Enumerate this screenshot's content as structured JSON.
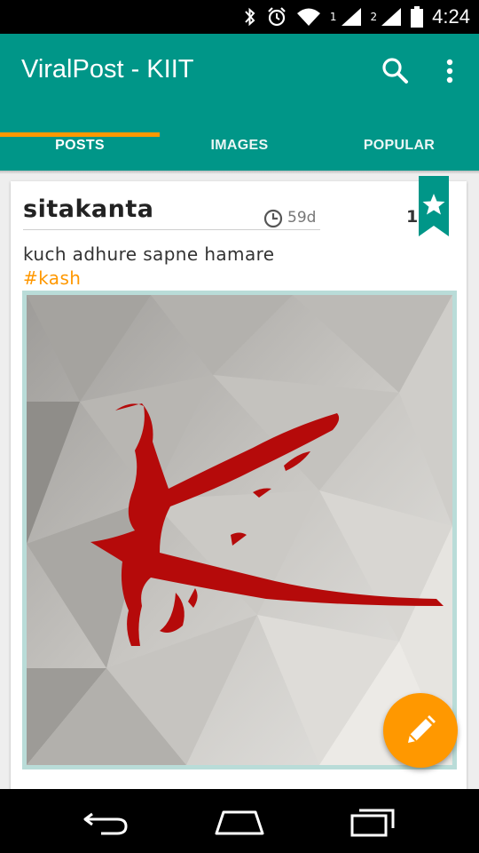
{
  "status_bar": {
    "time": "4:24",
    "sim1_label": "1",
    "sim2_label": "2",
    "icons": [
      "bluetooth-icon",
      "alarm-icon",
      "wifi-icon",
      "signal-icon",
      "signal-icon",
      "battery-icon"
    ]
  },
  "app_bar": {
    "title": "ViralPost - KIIT",
    "actions": [
      "search-icon",
      "more-vert-icon"
    ],
    "color": "#009688"
  },
  "tabs": [
    {
      "label": "POSTS",
      "selected": true
    },
    {
      "label": "IMAGES",
      "selected": false
    },
    {
      "label": "POPULAR",
      "selected": false
    }
  ],
  "tab_indicator_color": "#ff9800",
  "post": {
    "author": "sitakanta",
    "time_ago": "59d",
    "count": "1",
    "text": "kuch adhure sapne hamare",
    "hashtag": "#kash",
    "image_frame_color": "#b9dcd8",
    "bookmark_color": "#009688"
  },
  "fab": {
    "icon": "pencil-icon",
    "color": "#ff9800"
  },
  "nav_bar": {
    "icons": [
      "back-icon",
      "home-icon",
      "recent-apps-icon"
    ]
  }
}
